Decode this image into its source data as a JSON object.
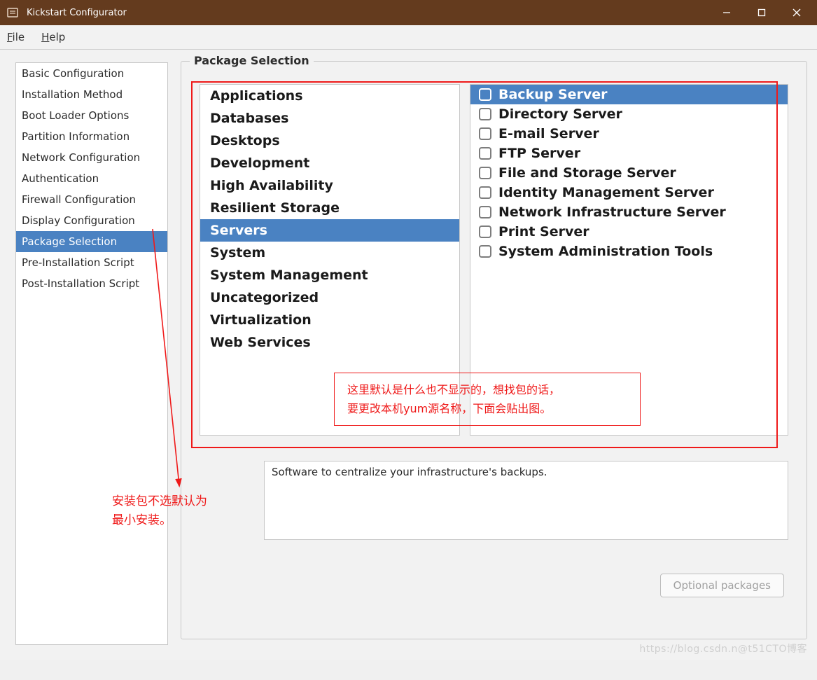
{
  "window": {
    "title": "Kickstart Configurator"
  },
  "menubar": {
    "file": "File",
    "help": "Help"
  },
  "sidebar": {
    "items": [
      {
        "label": "Basic Configuration"
      },
      {
        "label": "Installation Method"
      },
      {
        "label": "Boot Loader Options"
      },
      {
        "label": "Partition Information"
      },
      {
        "label": "Network Configuration"
      },
      {
        "label": "Authentication"
      },
      {
        "label": "Firewall Configuration"
      },
      {
        "label": "Display Configuration"
      },
      {
        "label": "Package Selection"
      },
      {
        "label": "Pre-Installation Script"
      },
      {
        "label": "Post-Installation Script"
      }
    ],
    "selected_index": 8
  },
  "main": {
    "legend": "Package Selection",
    "categories": [
      "Applications",
      "Databases",
      "Desktops",
      "Development",
      "High Availability",
      "Resilient Storage",
      "Servers",
      "System",
      "System Management",
      "Uncategorized",
      "Virtualization",
      "Web Services"
    ],
    "selected_category_index": 6,
    "packages": [
      {
        "label": "Backup Server",
        "checked": false
      },
      {
        "label": "Directory Server",
        "checked": false
      },
      {
        "label": "E-mail Server",
        "checked": false
      },
      {
        "label": "FTP Server",
        "checked": false
      },
      {
        "label": "File and Storage Server",
        "checked": false
      },
      {
        "label": "Identity Management Server",
        "checked": false
      },
      {
        "label": "Network Infrastructure Server",
        "checked": false
      },
      {
        "label": "Print Server",
        "checked": false
      },
      {
        "label": "System Administration Tools",
        "checked": false
      }
    ],
    "selected_package_index": 0,
    "description": "Software to centralize your infrastructure's backups.",
    "optional_packages_label": "Optional packages"
  },
  "annotations": {
    "note_box_line1": "这里默认是什么也不显示的，想找包的话，",
    "note_box_line2": "要更改本机yum源名称，下面会贴出图。",
    "side_line1": "安装包不选默认为",
    "side_line2": "最小安装。"
  },
  "watermark": "https://blog.csdn.n@t51CTO博客",
  "colors": {
    "titlebar": "#643b1e",
    "selection": "#4a82c2",
    "annotation": "#ef1a1a"
  }
}
